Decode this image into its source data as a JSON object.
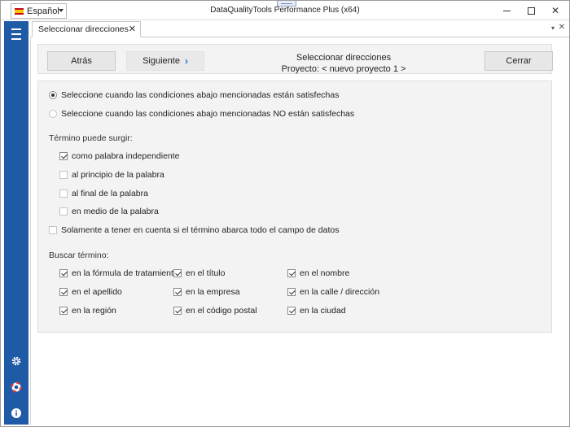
{
  "window": {
    "language": "Español",
    "title": "DataQualityTools Performance Plus (x64)",
    "controls": {
      "minimize": "minimize",
      "maximize": "maximize",
      "close": "✕"
    }
  },
  "tab": {
    "label": "Seleccionar direcciones",
    "close": "✕"
  },
  "header": {
    "back_label": "Atrás",
    "next_label": "Siguiente",
    "next_chevron": "›",
    "title_line1": "Seleccionar direcciones",
    "title_line2": "Proyecto: < nuevo proyecto 1 >",
    "close_label": "Cerrar"
  },
  "conditions": {
    "options": [
      {
        "label": "Seleccione cuando las condiciones abajo mencionadas están satisfechas",
        "selected": true
      },
      {
        "label": "Seleccione cuando las condiciones abajo mencionadas NO están satisfechas",
        "selected": false
      }
    ]
  },
  "term_occurs": {
    "label": "Término puede surgir:",
    "items": [
      {
        "label": "como palabra independiente",
        "checked": true
      },
      {
        "label": "al principio de la palabra",
        "checked": false
      },
      {
        "label": "al final de la palabra",
        "checked": false
      },
      {
        "label": "en medio de la palabra",
        "checked": false
      }
    ],
    "whole_field": {
      "label": "Solamente a tener en cuenta si el término abarca todo el campo de datos",
      "checked": false
    }
  },
  "search_term": {
    "label": "Buscar término:",
    "items": [
      {
        "label": "en la fórmula de tratamiento",
        "checked": true
      },
      {
        "label": "en el título",
        "checked": true
      },
      {
        "label": "en el nombre",
        "checked": true
      },
      {
        "label": "en el apellido",
        "checked": true
      },
      {
        "label": "en la empresa",
        "checked": true
      },
      {
        "label": "en la calle / dirección",
        "checked": true
      },
      {
        "label": "en la región",
        "checked": true
      },
      {
        "label": "en el código postal",
        "checked": true
      },
      {
        "label": "en la ciudad",
        "checked": true
      }
    ]
  },
  "colors": {
    "sidebar": "#1f5aa6",
    "panel": "#f3f3f3",
    "accent": "#1f6fd1"
  },
  "icons": {
    "menu": "hamburger-icon",
    "settings": "gear-icon",
    "help": "lifebuoy-icon",
    "info": "info-icon"
  }
}
